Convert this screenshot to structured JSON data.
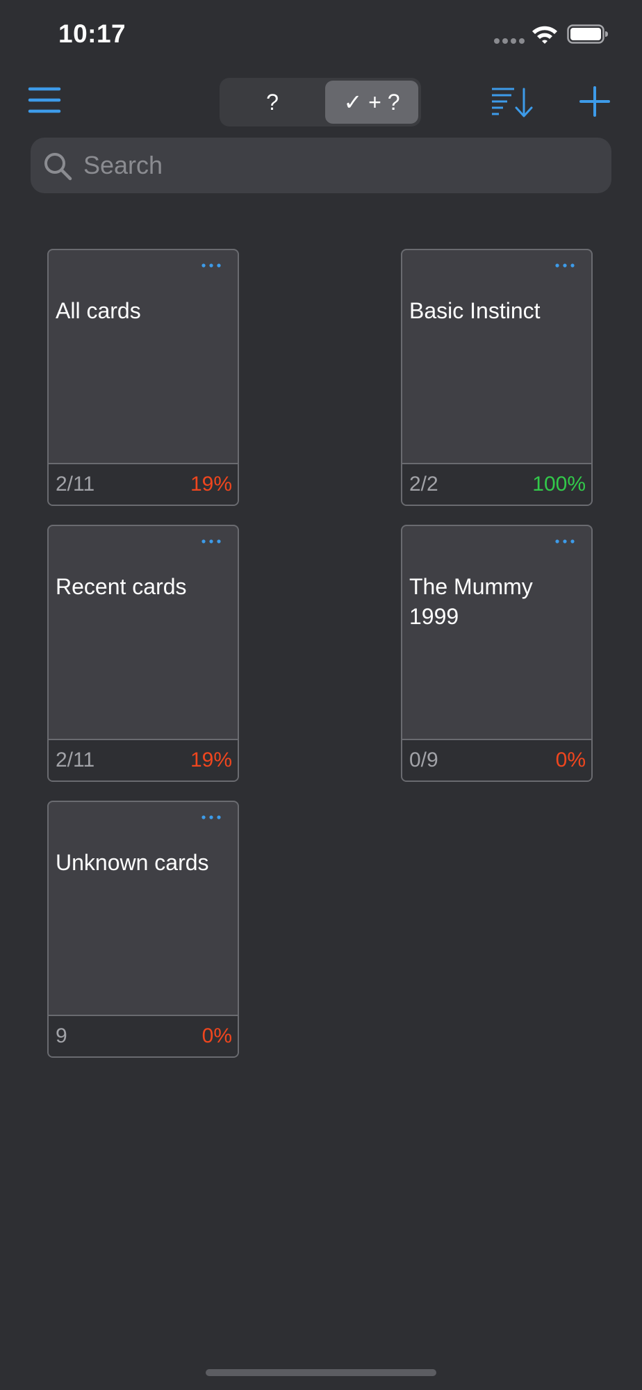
{
  "status_bar": {
    "time": "10:17"
  },
  "nav": {
    "menu_icon": "hamburger-menu-icon",
    "segments": [
      {
        "label": "?",
        "selected": false
      },
      {
        "label": "✓ + ?",
        "selected": true
      }
    ],
    "sort_icon": "sort-descending-icon",
    "add_icon": "plus-icon"
  },
  "search": {
    "placeholder": "Search",
    "value": ""
  },
  "colors": {
    "accent": "#3d9be9",
    "percent_low": "#f0461e",
    "percent_full": "#32c94a",
    "background": "#2e2f33",
    "card": "#404045"
  },
  "decks": [
    {
      "title": "All cards",
      "count": "2/11",
      "percent": "19%",
      "percent_status": "low"
    },
    {
      "title": "Basic Instinct",
      "count": "2/2",
      "percent": "100%",
      "percent_status": "full"
    },
    {
      "title": "Recent cards",
      "count": "2/11",
      "percent": "19%",
      "percent_status": "low"
    },
    {
      "title": "The Mummy 1999",
      "count": "0/9",
      "percent": "0%",
      "percent_status": "low"
    },
    {
      "title": "Unknown cards",
      "count": "9",
      "percent": "0%",
      "percent_status": "low"
    }
  ]
}
